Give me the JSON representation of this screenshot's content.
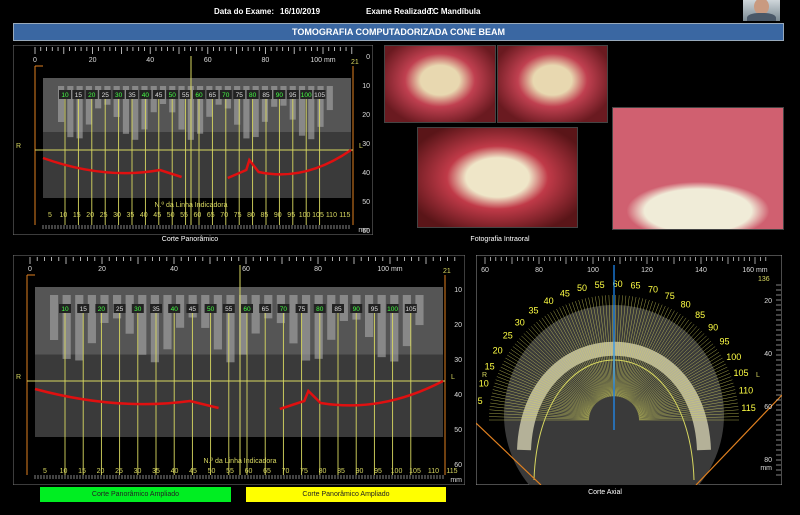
{
  "header": {
    "exam_date_label": "Data do Exame:",
    "exam_date": "16/10/2019",
    "exam_type_label": "Exame Realizado:",
    "exam_type": "TC Mandíbula"
  },
  "title": "TOMOGRAFIA COMPUTADORIZADA CONE BEAM",
  "pano_top": {
    "caption": "Corte Panorâmico",
    "ruler_labels": [
      "0",
      "20",
      "40",
      "60",
      "80",
      "100 mm"
    ],
    "side_right": "R",
    "side_left": "L",
    "slice_number": "21",
    "line_labels": [
      "10",
      "15",
      "20",
      "25",
      "30",
      "35",
      "40",
      "45",
      "50",
      "55",
      "60",
      "65",
      "70",
      "75",
      "80",
      "85",
      "90",
      "95",
      "100",
      "105"
    ],
    "bottom_labels": [
      "5",
      "10",
      "15",
      "20",
      "25",
      "30",
      "35",
      "40",
      "45",
      "50",
      "55",
      "60",
      "65",
      "70",
      "75",
      "80",
      "85",
      "90",
      "95",
      "100",
      "105",
      "110",
      "115"
    ],
    "indicator_label": "N.º da Linha Indicadora",
    "depth_labels": [
      "0",
      "10",
      "20",
      "30",
      "40",
      "50",
      "60"
    ],
    "depth_unit": "mm"
  },
  "photos": {
    "caption": "Fotografia Intraoral"
  },
  "pano_bottom": {
    "ruler_labels": [
      "0",
      "20",
      "40",
      "60",
      "80",
      "100 mm"
    ],
    "side_right": "R",
    "side_left": "L",
    "slice_number": "21",
    "line_labels": [
      "10",
      "15",
      "20",
      "25",
      "30",
      "35",
      "40",
      "45",
      "50",
      "55",
      "60",
      "65",
      "70",
      "75",
      "80",
      "85",
      "90",
      "95",
      "100",
      "105"
    ],
    "bottom_labels": [
      "5",
      "10",
      "15",
      "20",
      "25",
      "30",
      "35",
      "40",
      "45",
      "50",
      "55",
      "60",
      "65",
      "70",
      "75",
      "80",
      "85",
      "90",
      "95",
      "100",
      "105",
      "110",
      "115"
    ],
    "indicator_label": "N.º da Linha Indicadora",
    "depth_labels": [
      "10",
      "20",
      "30",
      "40",
      "50",
      "60"
    ],
    "depth_unit": "mm"
  },
  "buttons": {
    "green": "Corte Panorâmico Ampliado",
    "yellow": "Corte Panorâmico Ampliado"
  },
  "axial": {
    "caption": "Corte Axial",
    "ruler_labels": [
      "60",
      "80",
      "100",
      "120",
      "140",
      "160 mm"
    ],
    "slice_number": "136",
    "side_right": "R",
    "side_left": "L",
    "fan_labels": [
      "5",
      "10",
      "15",
      "20",
      "25",
      "30",
      "35",
      "40",
      "45",
      "50",
      "55",
      "60",
      "65",
      "70",
      "75",
      "80",
      "85",
      "90",
      "95",
      "100",
      "105",
      "110",
      "115"
    ],
    "depth_labels": [
      "20",
      "40",
      "60",
      "80"
    ],
    "depth_unit": "mm"
  },
  "colors": {
    "title_bar": "#3a67a2",
    "line_yellow": "#d8d860",
    "curve_red": "#e01010",
    "green_button": "#00ee22",
    "yellow_button": "#ffff00",
    "axis_blue": "#1e90ff",
    "orange": "#e08020"
  }
}
